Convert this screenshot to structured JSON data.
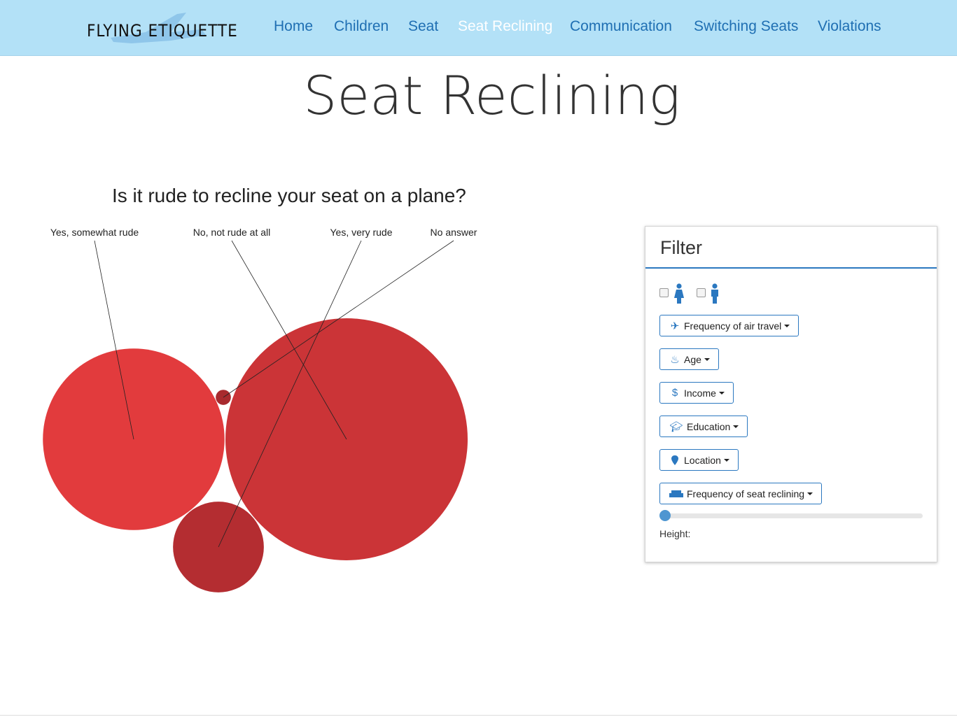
{
  "brand": {
    "name": "FLYING ETIQUETTE",
    "logo_icon": "airplane-icon"
  },
  "nav": {
    "items": [
      {
        "label": "Home",
        "active": false
      },
      {
        "label": "Children",
        "active": false
      },
      {
        "label": "Seat",
        "active": false
      },
      {
        "label": "Seat Reclining",
        "active": true
      },
      {
        "label": "Communication",
        "active": false
      },
      {
        "label": "Switching Seats",
        "active": false
      },
      {
        "label": "Violations",
        "active": false
      }
    ]
  },
  "page": {
    "title": "Seat Reclining"
  },
  "chart_data": {
    "type": "bubble",
    "title": "Is it rude to recline your seat on a plane?",
    "series": [
      {
        "name": "Yes, somewhat rude",
        "value": 0.36,
        "color": "#e23b3d"
      },
      {
        "name": "No, not rude at all",
        "value": 0.64,
        "color": "#cb3437"
      },
      {
        "name": "Yes, very rude",
        "value": 0.09,
        "color": "#b42d31"
      },
      {
        "name": "No answer",
        "value": 0.0025,
        "color": "#a82a2e"
      }
    ]
  },
  "filter": {
    "title": "Filter",
    "gender_icons": [
      "female-icon",
      "male-icon"
    ],
    "buttons": [
      {
        "label": "Frequency of air travel",
        "icon": "plane-icon"
      },
      {
        "label": "Age",
        "icon": "birthday-cake-icon"
      },
      {
        "label": "Income",
        "icon": "dollar-icon"
      },
      {
        "label": "Education",
        "icon": "graduation-cap-icon"
      },
      {
        "label": "Location",
        "icon": "map-marker-icon"
      },
      {
        "label": "Frequency of seat reclining",
        "icon": "couch-icon"
      }
    ],
    "slider": {
      "value": 0
    },
    "height_label": "Height:"
  },
  "colors": {
    "navbar": "#b3e1f7",
    "link": "#1f6fb3",
    "accent": "#2b78c0"
  }
}
